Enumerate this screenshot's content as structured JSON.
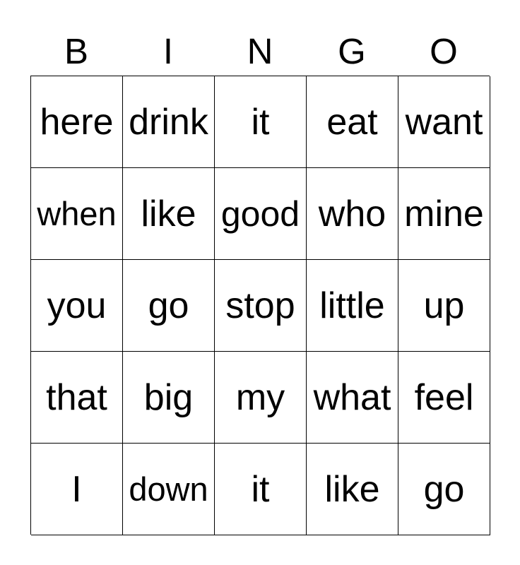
{
  "header": [
    "B",
    "I",
    "N",
    "G",
    "O"
  ],
  "cells": [
    [
      "here",
      "drink",
      "it",
      "eat",
      "want"
    ],
    [
      "when",
      "like",
      "good",
      "who",
      "mine"
    ],
    [
      "you",
      "go",
      "stop",
      "little",
      "up"
    ],
    [
      "that",
      "big",
      "my",
      "what",
      "feel"
    ],
    [
      "I",
      "down",
      "it",
      "like",
      "go"
    ]
  ]
}
